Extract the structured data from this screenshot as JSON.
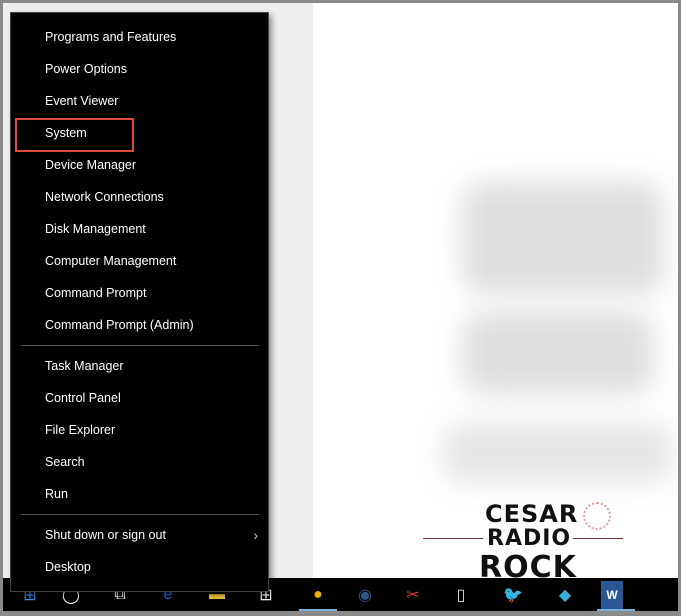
{
  "menu": {
    "group1": [
      "Programs and Features",
      "Power Options",
      "Event Viewer",
      "System",
      "Device Manager",
      "Network Connections",
      "Disk Management",
      "Computer Management",
      "Command Prompt",
      "Command Prompt (Admin)"
    ],
    "group2": [
      "Task Manager",
      "Control Panel",
      "File Explorer",
      "Search",
      "Run"
    ],
    "group3": [
      "Shut down or sign out",
      "Desktop"
    ],
    "highlighted": "System",
    "highlight_color": "#e04a3c"
  },
  "logo": {
    "line1": "CESAR",
    "line2": "RADIO",
    "line3": "ROCK"
  },
  "taskbar": {
    "icons": [
      "windows-start-icon",
      "search-icon",
      "task-view-icon",
      "edge-icon",
      "file-explorer-icon",
      "store-icon",
      "chrome-icon",
      "steam-icon",
      "snipping-tool-icon",
      "notepad-icon",
      "bird-app-icon",
      "kodi-icon",
      "word-icon"
    ],
    "active": [
      "chrome-icon",
      "word-icon"
    ]
  }
}
